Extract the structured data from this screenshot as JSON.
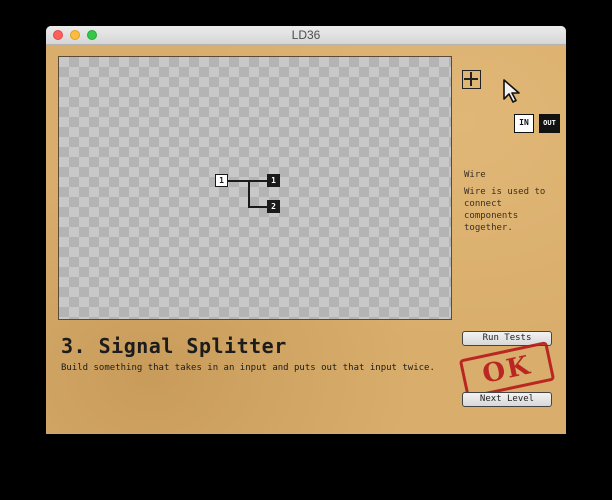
{
  "window": {
    "title": "LD36"
  },
  "canvas": {
    "input_node_label": "1",
    "output_nodes": [
      "1",
      "2"
    ]
  },
  "toolbox": {
    "add_tool": "plus-icon",
    "select_tool": "cursor-icon",
    "in_label": "IN",
    "out_label": "OUT"
  },
  "info": {
    "title": "Wire",
    "description": "Wire is used to connect components together."
  },
  "level": {
    "title": "3. Signal Splitter",
    "description": "Build something that takes in an input and puts out that input twice."
  },
  "buttons": {
    "run_tests": "Run Tests",
    "next_level": "Next Level"
  },
  "stamp": {
    "text": "OK",
    "color": "#b81c1c"
  }
}
